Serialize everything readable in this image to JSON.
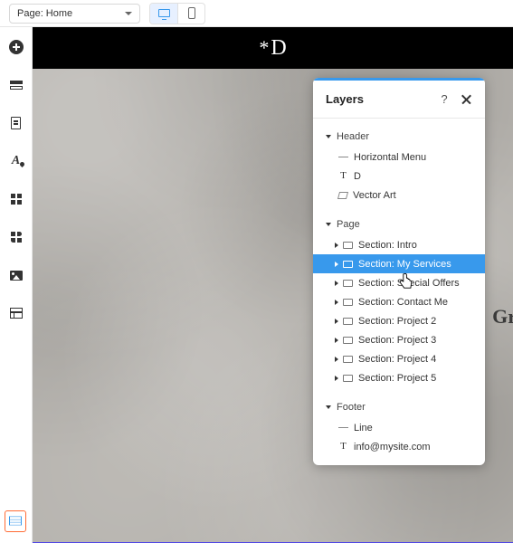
{
  "toolbar": {
    "page_label": "Page: Home"
  },
  "canvas": {
    "logo_text": "D",
    "side_text": "Gr"
  },
  "layers": {
    "title": "Layers",
    "groups": {
      "header": {
        "label": "Header",
        "items": [
          {
            "name": "horizontal-menu",
            "label": "Horizontal Menu",
            "icon": "line"
          },
          {
            "name": "text-d",
            "label": "D",
            "icon": "T"
          },
          {
            "name": "vector-art",
            "label": "Vector Art",
            "icon": "vec"
          }
        ]
      },
      "page": {
        "label": "Page",
        "sections": [
          {
            "label": "Section: Intro",
            "selected": false
          },
          {
            "label": "Section: My Services",
            "selected": true
          },
          {
            "label": "Section: Special Offers",
            "selected": false
          },
          {
            "label": "Section: Contact Me",
            "selected": false
          },
          {
            "label": "Section: Project 2",
            "selected": false
          },
          {
            "label": "Section: Project 3",
            "selected": false
          },
          {
            "label": "Section: Project 4",
            "selected": false
          },
          {
            "label": "Section: Project 5",
            "selected": false
          }
        ]
      },
      "footer": {
        "label": "Footer",
        "items": [
          {
            "name": "footer-line",
            "label": "Line",
            "icon": "line"
          },
          {
            "name": "footer-email",
            "label": "info@mysite.com",
            "icon": "T"
          }
        ]
      }
    }
  }
}
